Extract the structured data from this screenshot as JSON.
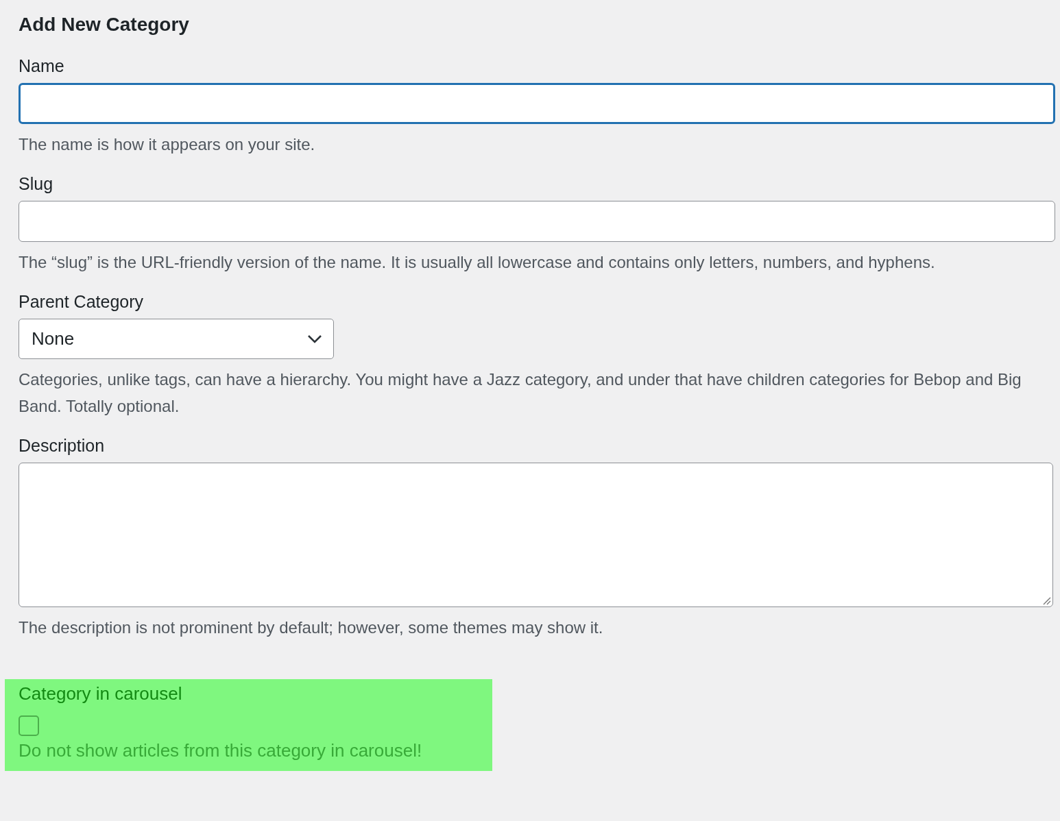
{
  "heading": "Add New Category",
  "fields": [
    {
      "kind": "text",
      "label": "Name",
      "focused": true,
      "help": "The name is how it appears on your site."
    },
    {
      "kind": "text",
      "label": "Slug",
      "focused": false,
      "help": "The “slug” is the URL-friendly version of the name. It is usually all lowercase and contains only letters, numbers, and hyphens."
    },
    {
      "kind": "select",
      "label": "Parent Category",
      "value": "None",
      "help": "Categories, unlike tags, can have a hierarchy. You might have a Jazz category, and under that have children categories for Bebop and Big Band. Totally optional."
    },
    {
      "kind": "textarea",
      "label": "Description",
      "focused": false,
      "help": "The description is not prominent by default; however, some themes may show it."
    }
  ],
  "carousel": {
    "label": "Category in carousel",
    "checked": false,
    "help": "Do not show articles from this category in carousel!"
  }
}
